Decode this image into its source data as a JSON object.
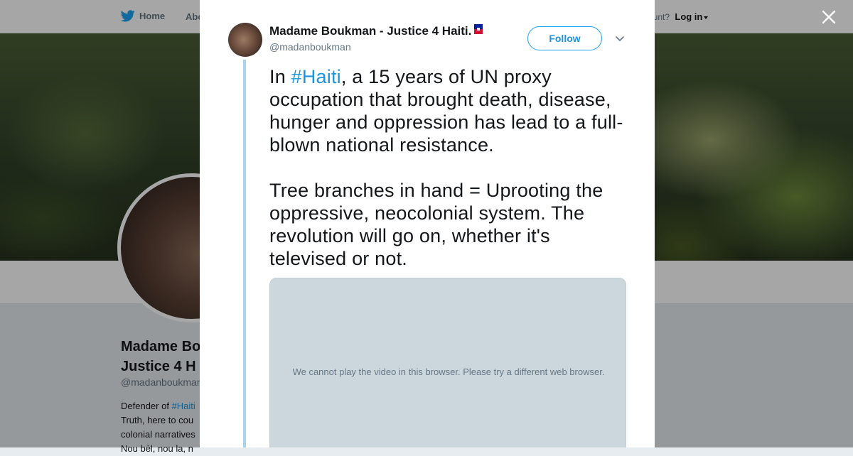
{
  "background": {
    "nav": {
      "home_label": "Home",
      "about_label": "Abo",
      "account_text": "ccount?",
      "login_label": "Log in"
    },
    "profile": {
      "name": "Madame Bo\nJustice 4 H",
      "handle": "@madanboukman",
      "bio_prefix": "Defender of ",
      "bio_tag": "#Haiti",
      "bio_line2": "Truth, here to cou",
      "bio_line3": "colonial narratives",
      "bio_line4": "Nou bèl, nou la, n"
    }
  },
  "modal": {
    "close_icon": "close-icon",
    "author": {
      "name": "Madame Boukman - Justice 4 Haiti.",
      "handle": "@madanboukman"
    },
    "follow_label": "Follow",
    "tweet": {
      "p1_before": "In ",
      "p1_tag": "#Haiti",
      "p1_after": ", a 15 years of UN proxy occupation that brought death, disease, hunger and oppression has lead to a full-blown national resistance.",
      "p2": "Tree branches in hand = Uprooting the oppressive, neocolonial system. The revolution will go on, whether it's televised or not."
    },
    "video_message": "We cannot play the video in this browser. Please try a different web browser."
  },
  "colors": {
    "accent": "#1da1f2",
    "link": "#1b95e0",
    "thread_line": "#a8d4f0",
    "video_bg": "#ccd6dd"
  }
}
